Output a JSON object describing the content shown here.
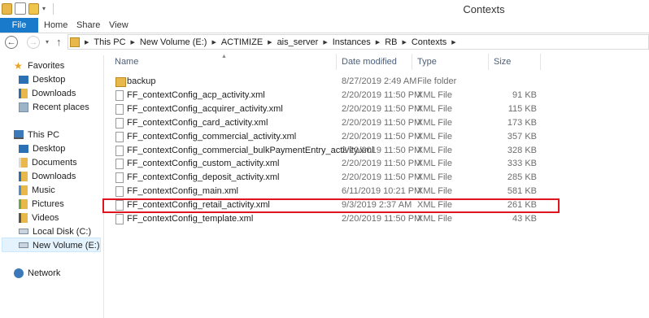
{
  "window": {
    "title": "Contexts"
  },
  "ribbon": {
    "tabs": [
      "File",
      "Home",
      "Share",
      "View"
    ]
  },
  "address": {
    "crumbs": [
      "This PC",
      "New Volume (E:)",
      "ACTIMIZE",
      "ais_server",
      "Instances",
      "RB",
      "Contexts"
    ]
  },
  "nav": {
    "favorites": "Favorites",
    "fav_items": [
      "Desktop",
      "Downloads",
      "Recent places"
    ],
    "this_pc": "This PC",
    "pc_items": [
      "Desktop",
      "Documents",
      "Downloads",
      "Music",
      "Pictures",
      "Videos",
      "Local Disk (C:)",
      "New Volume (E:)"
    ],
    "network": "Network"
  },
  "columns": {
    "name": "Name",
    "date": "Date modified",
    "type": "Type",
    "size": "Size"
  },
  "files": [
    {
      "name": "backup",
      "date": "8/27/2019 2:49 AM",
      "type": "File folder",
      "size": "",
      "icon": "folder-icon"
    },
    {
      "name": "FF_contextConfig_acp_activity.xml",
      "date": "2/20/2019 11:50 PM",
      "type": "XML File",
      "size": "91 KB",
      "icon": "xml-file-icon"
    },
    {
      "name": "FF_contextConfig_acquirer_activity.xml",
      "date": "2/20/2019 11:50 PM",
      "type": "XML File",
      "size": "115 KB",
      "icon": "xml-file-icon"
    },
    {
      "name": "FF_contextConfig_card_activity.xml",
      "date": "2/20/2019 11:50 PM",
      "type": "XML File",
      "size": "173 KB",
      "icon": "xml-file-icon"
    },
    {
      "name": "FF_contextConfig_commercial_activity.xml",
      "date": "2/20/2019 11:50 PM",
      "type": "XML File",
      "size": "357 KB",
      "icon": "xml-file-icon"
    },
    {
      "name": "FF_contextConfig_commercial_bulkPaymentEntry_activity.xml",
      "date": "2/20/2019 11:50 PM",
      "type": "XML File",
      "size": "328 KB",
      "icon": "xml-file-icon"
    },
    {
      "name": "FF_contextConfig_custom_activity.xml",
      "date": "2/20/2019 11:50 PM",
      "type": "XML File",
      "size": "333 KB",
      "icon": "xml-file-icon"
    },
    {
      "name": "FF_contextConfig_deposit_activity.xml",
      "date": "2/20/2019 11:50 PM",
      "type": "XML File",
      "size": "285 KB",
      "icon": "xml-file-icon"
    },
    {
      "name": "FF_contextConfig_main.xml",
      "date": "6/11/2019 10:21 PM",
      "type": "XML File",
      "size": "581 KB",
      "icon": "xml-file-icon"
    },
    {
      "name": "FF_contextConfig_retail_activity.xml",
      "date": "9/3/2019 2:37 AM",
      "type": "XML File",
      "size": "261 KB",
      "icon": "xml-file-icon"
    },
    {
      "name": "FF_contextConfig_template.xml",
      "date": "2/20/2019 11:50 PM",
      "type": "XML File",
      "size": "43 KB",
      "icon": "xml-file-icon"
    }
  ],
  "colors": {
    "file_tab": "#1979ca",
    "highlight": "#e0141e",
    "selection": "#e5f3ff",
    "header_text": "#4c607a"
  }
}
